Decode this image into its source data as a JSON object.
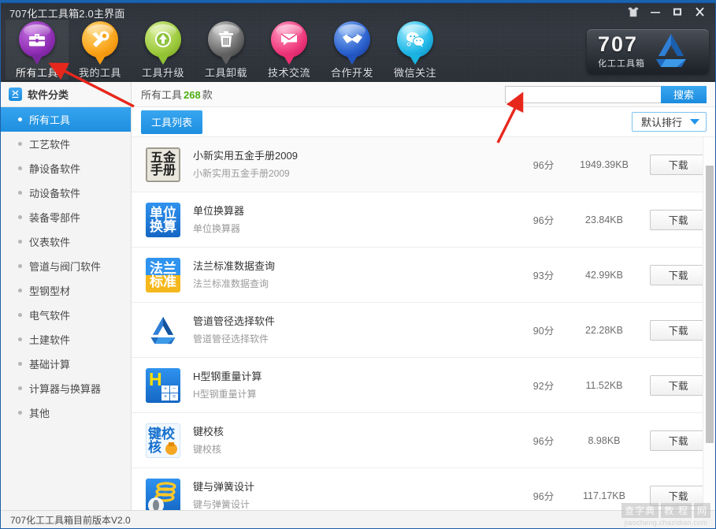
{
  "window": {
    "title": "707化工工具箱2.0主界面",
    "controls": [
      {
        "name": "skin-icon",
        "label": "皮肤"
      },
      {
        "name": "minimize-icon",
        "label": "最小化"
      },
      {
        "name": "maximize-icon",
        "label": "最大化"
      },
      {
        "name": "close-icon",
        "label": "关闭"
      }
    ]
  },
  "toolbar": {
    "items": [
      {
        "label": "所有工具",
        "icon": "briefcase-icon",
        "color": "#9b3fbe",
        "color2": "#6d1b8e",
        "tail": "#7d28a3",
        "active": true
      },
      {
        "label": "我的工具",
        "icon": "wrench-icon",
        "color": "#ffb52e",
        "color2": "#f08a00",
        "tail": "#f59b12",
        "active": false
      },
      {
        "label": "工具升级",
        "icon": "upgrade-arrow-icon",
        "color": "#a8d44c",
        "color2": "#7fb320",
        "tail": "#92c334",
        "active": false
      },
      {
        "label": "工具卸载",
        "icon": "trash-icon",
        "color": "#9a9a9a",
        "color2": "#4a4a4a",
        "tail": "#5f5f5f",
        "active": false
      },
      {
        "label": "技术交流",
        "icon": "chat-icon",
        "color": "#f4548c",
        "color2": "#e01a62",
        "tail": "#ea2f72",
        "active": false
      },
      {
        "label": "合作开发",
        "icon": "handshake-icon",
        "color": "#3b7de0",
        "color2": "#1c45ad",
        "tail": "#2355c0",
        "active": false
      },
      {
        "label": "微信关注",
        "icon": "wechat-icon",
        "color": "#3fd2f2",
        "color2": "#11a6d8",
        "tail": "#19b4e2",
        "active": false
      }
    ]
  },
  "logo": {
    "number": "707",
    "subtitle": "化工工具箱",
    "mark": "triangle-logo-icon"
  },
  "sidebar": {
    "header": {
      "label": "软件分类",
      "icon": "category-icon"
    },
    "items": [
      {
        "label": "所有工具",
        "active": true
      },
      {
        "label": "工艺软件",
        "active": false
      },
      {
        "label": "静设备软件",
        "active": false
      },
      {
        "label": "动设备软件",
        "active": false
      },
      {
        "label": "装备零部件",
        "active": false
      },
      {
        "label": "仪表软件",
        "active": false
      },
      {
        "label": "管道与阀门软件",
        "active": false
      },
      {
        "label": "型钢型材",
        "active": false
      },
      {
        "label": "电气软件",
        "active": false
      },
      {
        "label": "土建软件",
        "active": false
      },
      {
        "label": "基础计算",
        "active": false
      },
      {
        "label": "计算器与换算器",
        "active": false
      },
      {
        "label": "其他",
        "active": false
      }
    ]
  },
  "main": {
    "count_prefix": "所有工具",
    "count_value": "268",
    "count_suffix": "款",
    "search": {
      "value": "",
      "placeholder": "",
      "button_label": "搜索"
    },
    "tab_label": "工具列表",
    "sort_label": "默认排行",
    "download_label": "下载",
    "rows": [
      {
        "title": "小新实用五金手册2009",
        "subtitle": "小新实用五金手册2009",
        "score": "96分",
        "size": "1949.39KB",
        "icon": "wujin-manual-icon",
        "icon_l1": "五金",
        "icon_l2": "手册",
        "icon_bg": "#e9e6dd",
        "icon_fg": "#1f1f1f",
        "alt": true
      },
      {
        "title": "单位换算器",
        "subtitle": "单位换算器",
        "score": "96分",
        "size": "23.84KB",
        "icon": "unit-converter-icon",
        "icon_l1": "单位",
        "icon_l2": "换算",
        "icon_bg": "#1f7fe0",
        "icon_fg": "#ffffff",
        "alt": false
      },
      {
        "title": "法兰标准数据查询",
        "subtitle": "法兰标准数据查询",
        "score": "93分",
        "size": "42.99KB",
        "icon": "flange-standard-icon",
        "icon_l1": "法兰",
        "icon_l2": "标准",
        "icon_bg": "#1f7fe0",
        "icon_fg": "#ffffff",
        "alt": false
      },
      {
        "title": "管道管径选择软件",
        "subtitle": "管道管径选择软件",
        "score": "90分",
        "size": "22.28KB",
        "icon": "pipe-diameter-icon",
        "icon_l1": "",
        "icon_l2": "",
        "icon_bg": "#ffffff",
        "icon_fg": "#1f6fc4",
        "alt": false
      },
      {
        "title": "H型钢重量计算",
        "subtitle": "H型钢重量计算",
        "score": "92分",
        "size": "11.52KB",
        "icon": "h-beam-weight-icon",
        "icon_l1": "H",
        "icon_l2": "",
        "icon_bg": "#1f7fe0",
        "icon_fg": "#ffe000",
        "alt": false
      },
      {
        "title": "键校核",
        "subtitle": "键校核",
        "score": "96分",
        "size": "8.98KB",
        "icon": "key-check-icon",
        "icon_l1": "键校",
        "icon_l2": "核",
        "icon_bg": "#f2f8ff",
        "icon_fg": "#1f7fe0",
        "alt": false
      },
      {
        "title": "键与弹簧设计",
        "subtitle": "键与弹簧设计",
        "score": "96分",
        "size": "117.17KB",
        "icon": "key-spring-design-icon",
        "icon_l1": "",
        "icon_l2": "",
        "icon_bg": "#1f7fe0",
        "icon_fg": "#ffc020",
        "alt": false
      }
    ]
  },
  "statusbar": {
    "text": "707化工工具箱目前版本V2.0"
  },
  "watermark": {
    "part1": "查字典",
    "part2": "教 程",
    "part3": "网",
    "url": "jiaocheng.chazidian.com"
  }
}
